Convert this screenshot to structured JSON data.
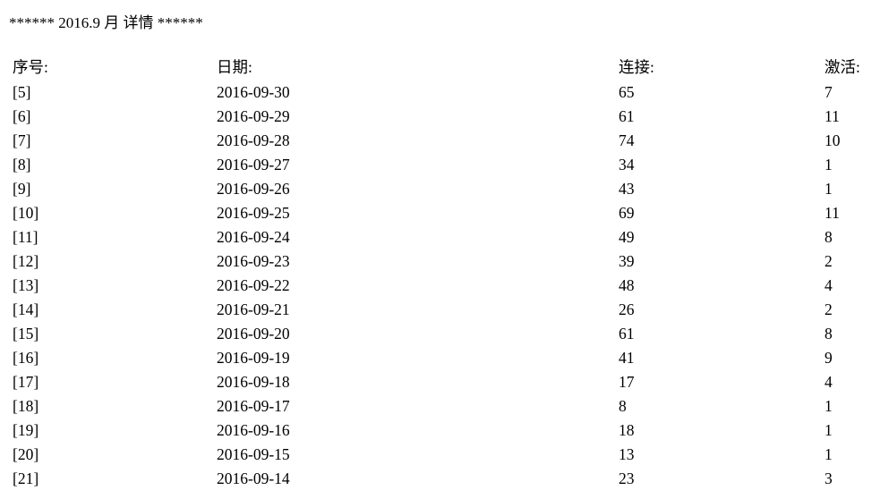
{
  "title": "****** 2016.9 月 详情 ******",
  "table": {
    "headers": [
      "序号:",
      "日期:",
      "连接:",
      "激活:"
    ],
    "rows": [
      [
        "[5]",
        "2016-09-30",
        "65",
        "7"
      ],
      [
        "[6]",
        "2016-09-29",
        "61",
        "11"
      ],
      [
        "[7]",
        "2016-09-28",
        "74",
        "10"
      ],
      [
        "[8]",
        "2016-09-27",
        "34",
        "1"
      ],
      [
        "[9]",
        "2016-09-26",
        "43",
        "1"
      ],
      [
        "[10]",
        "2016-09-25",
        "69",
        "11"
      ],
      [
        "[11]",
        "2016-09-24",
        "49",
        "8"
      ],
      [
        "[12]",
        "2016-09-23",
        "39",
        "2"
      ],
      [
        "[13]",
        "2016-09-22",
        "48",
        "4"
      ],
      [
        "[14]",
        "2016-09-21",
        "26",
        "2"
      ],
      [
        "[15]",
        "2016-09-20",
        "61",
        "8"
      ],
      [
        "[16]",
        "2016-09-19",
        "41",
        "9"
      ],
      [
        "[17]",
        "2016-09-18",
        "17",
        "4"
      ],
      [
        "[18]",
        "2016-09-17",
        "8",
        "1"
      ],
      [
        "[19]",
        "2016-09-16",
        "18",
        "1"
      ],
      [
        "[20]",
        "2016-09-15",
        "13",
        "1"
      ],
      [
        "[21]",
        "2016-09-14",
        "23",
        "3"
      ]
    ]
  }
}
